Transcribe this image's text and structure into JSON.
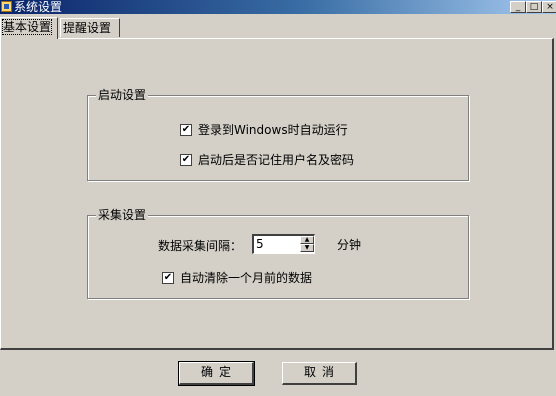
{
  "window": {
    "title": "系统设置",
    "controls": {
      "minimize": "_",
      "maximize": "□",
      "close": "×"
    }
  },
  "tabs": [
    {
      "label": "基本设置",
      "active": true
    },
    {
      "label": "提醒设置",
      "active": false
    }
  ],
  "startup_group": {
    "title": "启动设置",
    "options": [
      {
        "label": "登录到Windows时自动运行",
        "checked": true
      },
      {
        "label": "启动后是否记住用户名及密码",
        "checked": true
      }
    ]
  },
  "collect_group": {
    "title": "采集设置",
    "interval_label": "数据采集间隔：",
    "interval_value": "5",
    "interval_unit": "分钟",
    "clear_option": {
      "label": "自动清除一个月前的数据",
      "checked": true
    }
  },
  "buttons": {
    "ok": "确定",
    "cancel": "取消"
  },
  "check_mark": "✔",
  "spin_arrows": {
    "up": "▲",
    "down": "▼"
  }
}
